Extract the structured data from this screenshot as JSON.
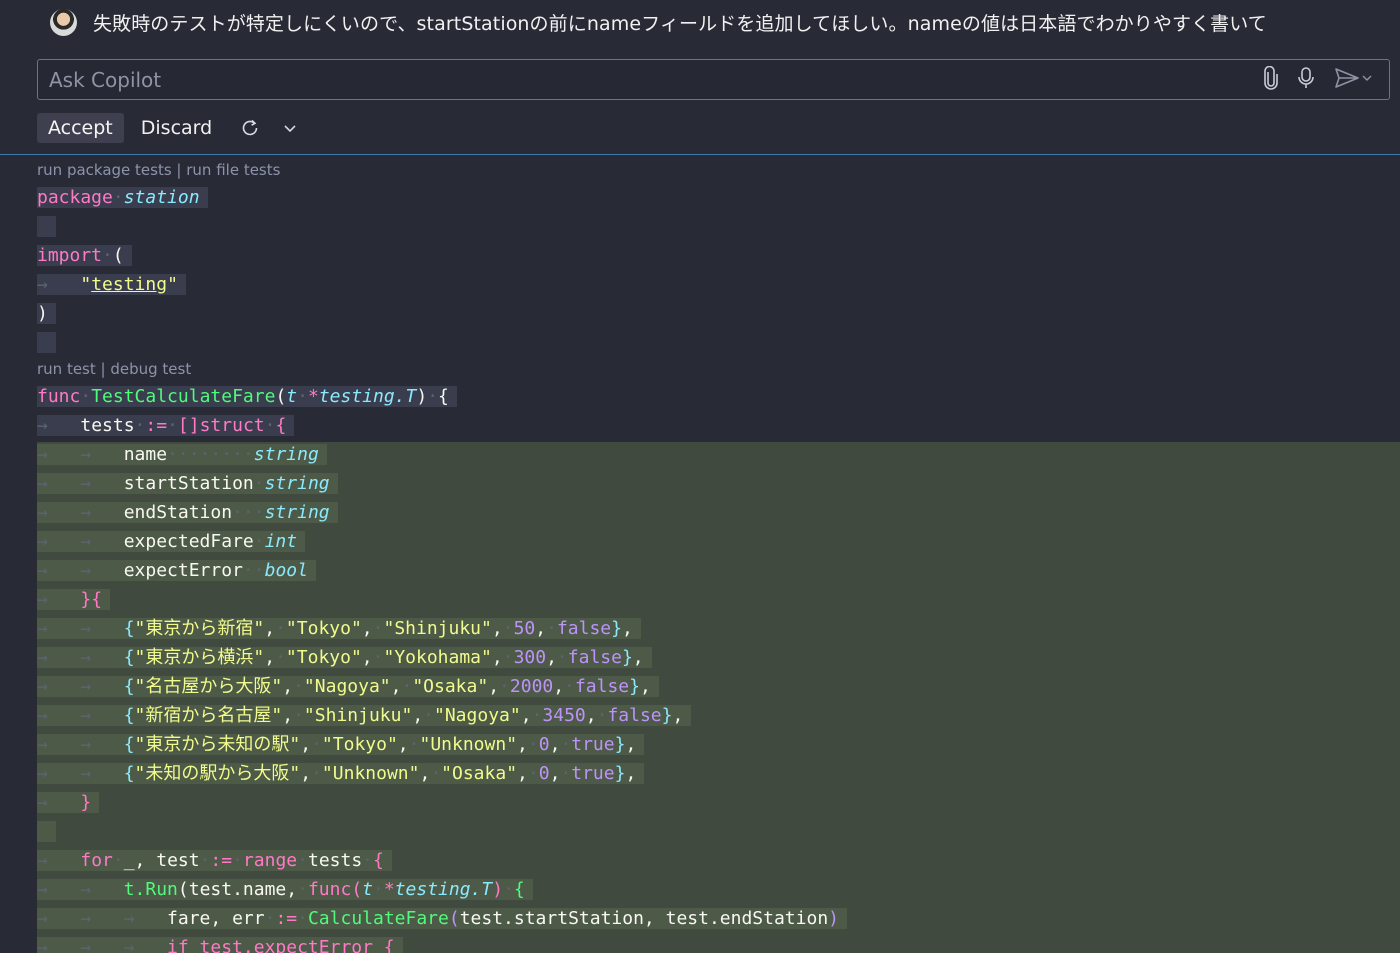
{
  "chat": {
    "prompt": "失敗時のテストが特定しにくいので、startStationの前にnameフィールドを追加してほしい。nameの値は日本語でわかりやすく書いて",
    "ask_placeholder": "Ask Copilot",
    "accept_label": "Accept",
    "discard_label": "Discard"
  },
  "codelens": {
    "package": "run package tests | run file tests",
    "func": "run test | debug test"
  },
  "code": {
    "package_kw": "package",
    "package_name": "station",
    "import_kw": "import",
    "import_path": "testing",
    "func_kw": "func",
    "func_name": "TestCalculateFare",
    "param": "t",
    "param_type": "testing.T",
    "tests_var": "tests",
    "struct_kw": "[]struct",
    "fields": [
      {
        "name": "name",
        "type": "string"
      },
      {
        "name": "startStation",
        "type": "string"
      },
      {
        "name": "endStation",
        "type": "string"
      },
      {
        "name": "expectedFare",
        "type": "int"
      },
      {
        "name": "expectError",
        "type": "bool"
      }
    ],
    "cases": [
      {
        "label": "東京から新宿",
        "start": "Tokyo",
        "end": "Shinjuku",
        "fare": "50",
        "err": "false"
      },
      {
        "label": "東京から横浜",
        "start": "Tokyo",
        "end": "Yokohama",
        "fare": "300",
        "err": "false"
      },
      {
        "label": "名古屋から大阪",
        "start": "Nagoya",
        "end": "Osaka",
        "fare": "2000",
        "err": "false"
      },
      {
        "label": "新宿から名古屋",
        "start": "Shinjuku",
        "end": "Nagoya",
        "fare": "3450",
        "err": "false"
      },
      {
        "label": "東京から未知の駅",
        "start": "Tokyo",
        "end": "Unknown",
        "fare": "0",
        "err": "true"
      },
      {
        "label": "未知の駅から大阪",
        "start": "Unknown",
        "end": "Osaka",
        "fare": "0",
        "err": "true"
      }
    ],
    "for_kw": "for",
    "loop_vars": "_, test",
    "range_kw": "range",
    "run_call": "t.Run",
    "run_args": "test.name",
    "calc_lhs": "fare, err",
    "calc_fn": "CalculateFare",
    "calc_args": "test.startStation, test.endStation",
    "if_line": "if test.expectError {"
  }
}
